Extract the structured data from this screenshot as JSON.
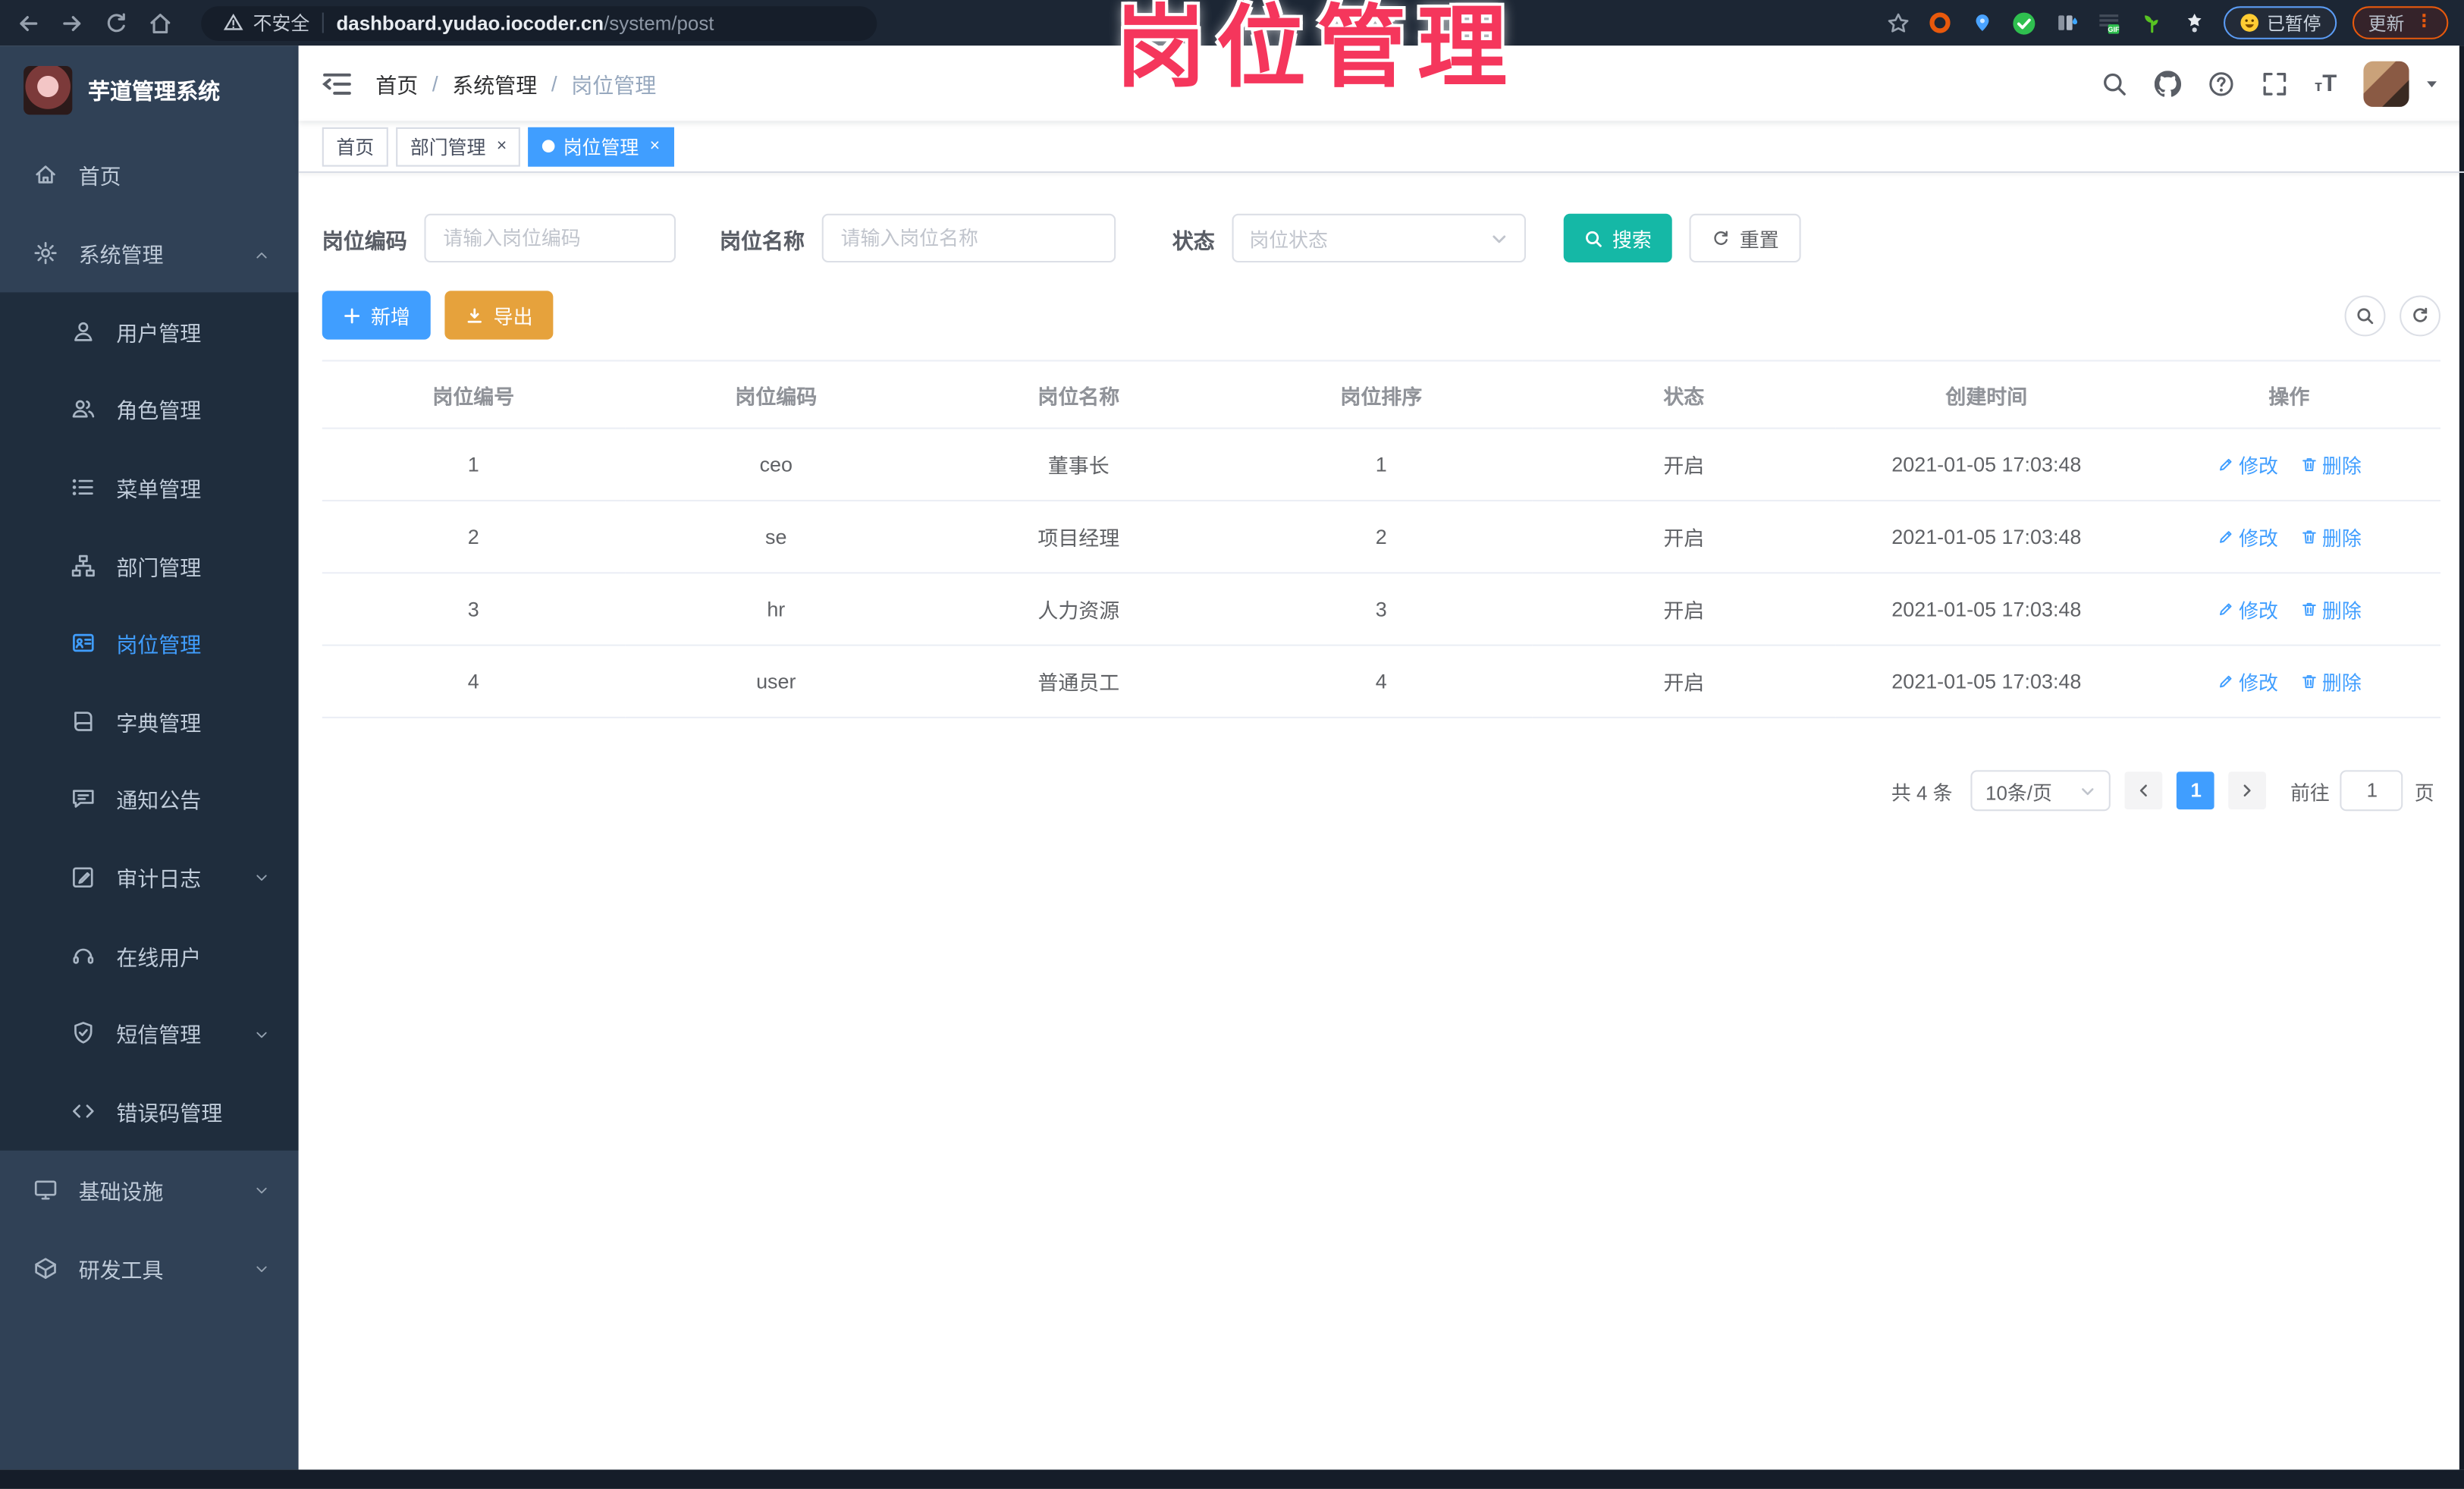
{
  "browser": {
    "security_label": "不安全",
    "url_host": "dashboard.yudao.iocoder.cn",
    "url_path": "/system/post",
    "paused_label": "已暂停",
    "update_label": "更新"
  },
  "annotation": {
    "text": "岗位管理",
    "color": "#f5365c"
  },
  "sidebar": {
    "title": "芋道管理系统",
    "items": [
      {
        "label": "首页",
        "icon": "home-icon",
        "level": 1
      },
      {
        "label": "系统管理",
        "icon": "gear-icon",
        "level": 1,
        "chevron": "up"
      },
      {
        "label": "用户管理",
        "icon": "user-icon",
        "level": 2
      },
      {
        "label": "角色管理",
        "icon": "role-icon",
        "level": 2
      },
      {
        "label": "菜单管理",
        "icon": "menu-icon",
        "level": 2
      },
      {
        "label": "部门管理",
        "icon": "dept-icon",
        "level": 2
      },
      {
        "label": "岗位管理",
        "icon": "post-icon",
        "level": 2,
        "active": true
      },
      {
        "label": "字典管理",
        "icon": "dict-icon",
        "level": 2
      },
      {
        "label": "通知公告",
        "icon": "notice-icon",
        "level": 2
      },
      {
        "label": "审计日志",
        "icon": "audit-icon",
        "level": 2,
        "chevron": "down"
      },
      {
        "label": "在线用户",
        "icon": "online-icon",
        "level": 2
      },
      {
        "label": "短信管理",
        "icon": "sms-icon",
        "level": 2,
        "chevron": "down"
      },
      {
        "label": "错误码管理",
        "icon": "errcode-icon",
        "level": 2
      },
      {
        "label": "基础设施",
        "icon": "infra-icon",
        "level": 1,
        "chevron": "down"
      },
      {
        "label": "研发工具",
        "icon": "devtool-icon",
        "level": 1,
        "chevron": "down"
      }
    ]
  },
  "header": {
    "breadcrumb": [
      "首页",
      "系统管理",
      "岗位管理"
    ]
  },
  "tabs": [
    {
      "label": "首页",
      "closable": false,
      "active": false
    },
    {
      "label": "部门管理",
      "closable": true,
      "active": false
    },
    {
      "label": "岗位管理",
      "closable": true,
      "active": true
    }
  ],
  "filters": {
    "code_label": "岗位编码",
    "code_placeholder": "请输入岗位编码",
    "name_label": "岗位名称",
    "name_placeholder": "请输入岗位名称",
    "status_label": "状态",
    "status_placeholder": "岗位状态",
    "search_label": "搜索",
    "reset_label": "重置"
  },
  "toolbar": {
    "add_label": "新增",
    "export_label": "导出"
  },
  "table": {
    "columns": [
      "岗位编号",
      "岗位编码",
      "岗位名称",
      "岗位排序",
      "状态",
      "创建时间",
      "操作"
    ],
    "modify_label": "修改",
    "delete_label": "删除",
    "rows": [
      {
        "id": "1",
        "code": "ceo",
        "name": "董事长",
        "sort": "1",
        "status": "开启",
        "created": "2021-01-05 17:03:48"
      },
      {
        "id": "2",
        "code": "se",
        "name": "项目经理",
        "sort": "2",
        "status": "开启",
        "created": "2021-01-05 17:03:48"
      },
      {
        "id": "3",
        "code": "hr",
        "name": "人力资源",
        "sort": "3",
        "status": "开启",
        "created": "2021-01-05 17:03:48"
      },
      {
        "id": "4",
        "code": "user",
        "name": "普通员工",
        "sort": "4",
        "status": "开启",
        "created": "2021-01-05 17:03:48"
      }
    ]
  },
  "pagination": {
    "total_label": "共 4 条",
    "page_size": "10条/页",
    "current_page": "1",
    "goto_label": "前往",
    "goto_value": "1",
    "page_label": "页"
  },
  "colors": {
    "primary": "#409EFF",
    "warning": "#E6A23C",
    "search_teal": "#15b8a6",
    "annotation_pink": "#f5365c"
  }
}
